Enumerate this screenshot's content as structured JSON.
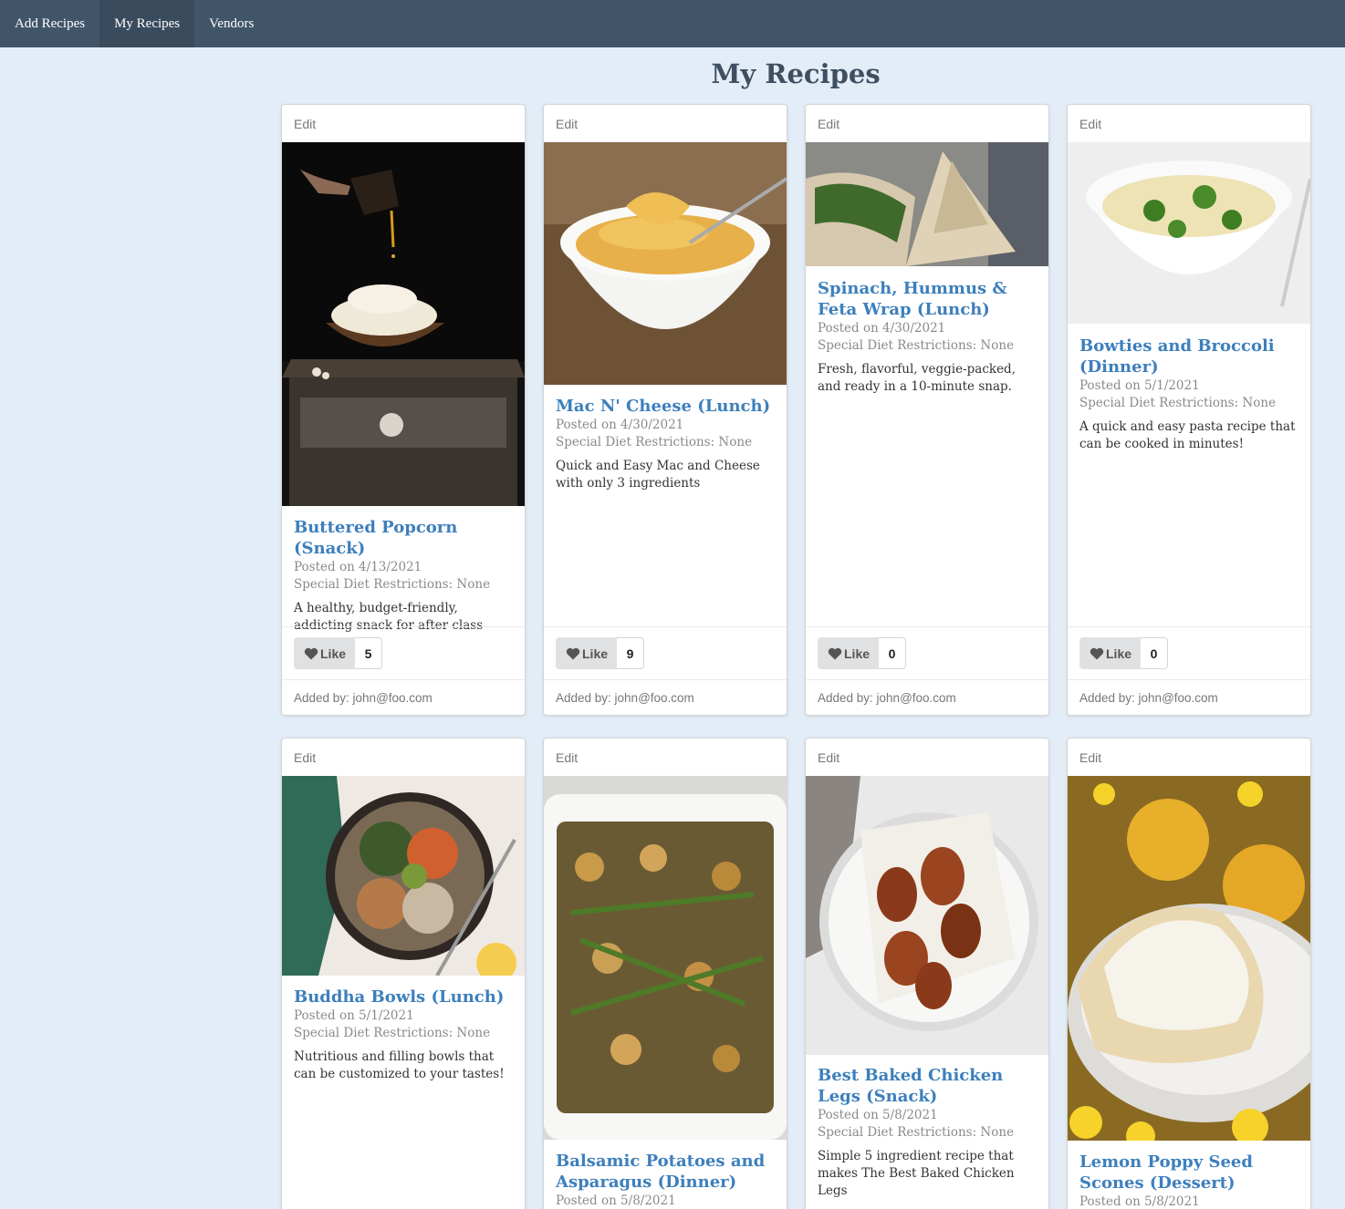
{
  "nav": {
    "items": [
      {
        "label": "Add Recipes"
      },
      {
        "label": "My Recipes"
      },
      {
        "label": "Vendors"
      }
    ]
  },
  "page": {
    "title": "My Recipes"
  },
  "cards": [
    {
      "edit": "Edit",
      "title": "Buttered Popcorn (Snack)",
      "posted": "Posted on 4/13/2021",
      "diet": "Special Diet Restrictions: None",
      "desc": "A healthy, budget-friendly, addicting snack for after class",
      "like_label": "Like",
      "likes": "5",
      "added_by": "Added by: john@foo.com"
    },
    {
      "edit": "Edit",
      "title": "Mac N' Cheese (Lunch)",
      "posted": "Posted on 4/30/2021",
      "diet": "Special Diet Restrictions: None",
      "desc": "Quick and Easy Mac and Cheese with only 3 ingredients",
      "like_label": "Like",
      "likes": "9",
      "added_by": "Added by: john@foo.com"
    },
    {
      "edit": "Edit",
      "title": "Spinach, Hummus & Feta Wrap (Lunch)",
      "posted": "Posted on 4/30/2021",
      "diet": "Special Diet Restrictions: None",
      "desc": "Fresh, flavorful, veggie-packed, and ready in a 10-minute snap.",
      "like_label": "Like",
      "likes": "0",
      "added_by": "Added by: john@foo.com"
    },
    {
      "edit": "Edit",
      "title": "Bowties and Broccoli (Dinner)",
      "posted": "Posted on 5/1/2021",
      "diet": "Special Diet Restrictions: None",
      "desc": "A quick and easy pasta recipe that can be cooked in minutes!",
      "like_label": "Like",
      "likes": "0",
      "added_by": "Added by: john@foo.com"
    },
    {
      "edit": "Edit",
      "title": "Buddha Bowls (Lunch)",
      "posted": "Posted on 5/1/2021",
      "diet": "Special Diet Restrictions: None",
      "desc": "Nutritious and filling bowls that can be customized to your tastes!"
    },
    {
      "edit": "Edit",
      "title": "Balsamic Potatoes and Asparagus (Dinner)",
      "posted": "Posted on 5/8/2021"
    },
    {
      "edit": "Edit",
      "title": "Best Baked Chicken Legs (Snack)",
      "posted": "Posted on 5/8/2021",
      "diet": "Special Diet Restrictions: None",
      "desc": "Simple 5 ingredient recipe that makes The Best Baked Chicken Legs"
    },
    {
      "edit": "Edit",
      "title": "Lemon Poppy Seed Scones (Dessert)",
      "posted": "Posted on 5/8/2021"
    }
  ]
}
